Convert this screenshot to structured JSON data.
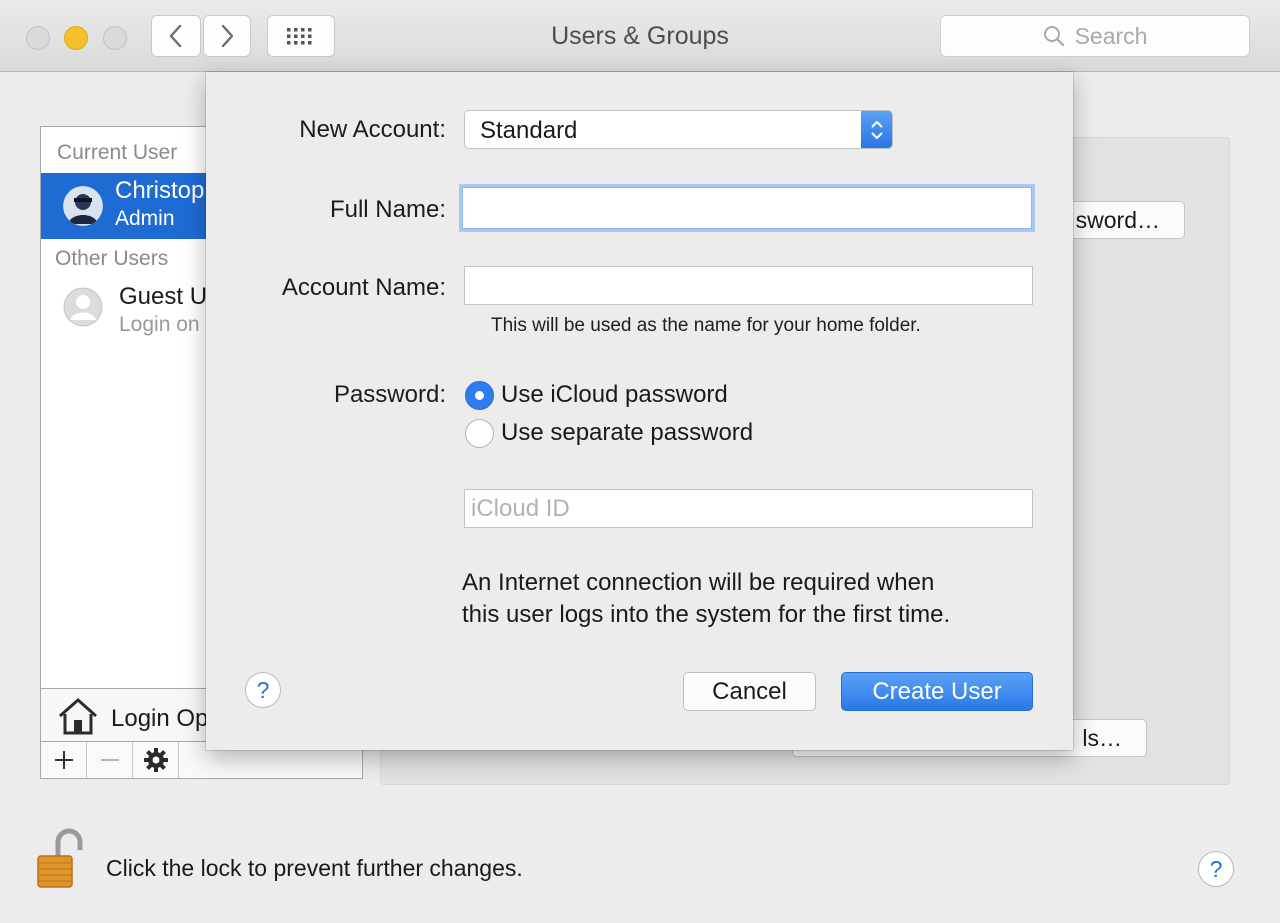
{
  "window": {
    "title": "Users & Groups"
  },
  "search": {
    "placeholder": "Search"
  },
  "sidebar": {
    "current_user_label": "Current User",
    "current_user": {
      "name": "Christop",
      "role": "Admin"
    },
    "other_users_label": "Other Users",
    "guest": {
      "name": "Guest U",
      "sub": "Login on"
    },
    "login_options_label": "Login Op"
  },
  "background_buttons": {
    "password_label": "sword…",
    "parental_label": "ls…"
  },
  "footer": {
    "lock_text": "Click the lock to prevent further changes.",
    "help": "?"
  },
  "sheet": {
    "new_account_label": "New Account:",
    "new_account_value": "Standard",
    "full_name_label": "Full Name:",
    "full_name_value": "",
    "account_name_label": "Account Name:",
    "account_name_value": "",
    "account_name_hint": "This will be used as the name for your home folder.",
    "password_label": "Password:",
    "password_options": [
      {
        "label": "Use iCloud password",
        "selected": true
      },
      {
        "label": "Use separate password",
        "selected": false
      }
    ],
    "icloud_id_placeholder": "iCloud ID",
    "note_line1": "An Internet connection will be required when",
    "note_line2": "this user logs into the system for the first time.",
    "help": "?",
    "cancel_label": "Cancel",
    "create_label": "Create User"
  },
  "colors": {
    "accent": "#2d7cf0",
    "selection": "#1f6bd4",
    "minimize": "#f6c02b"
  }
}
